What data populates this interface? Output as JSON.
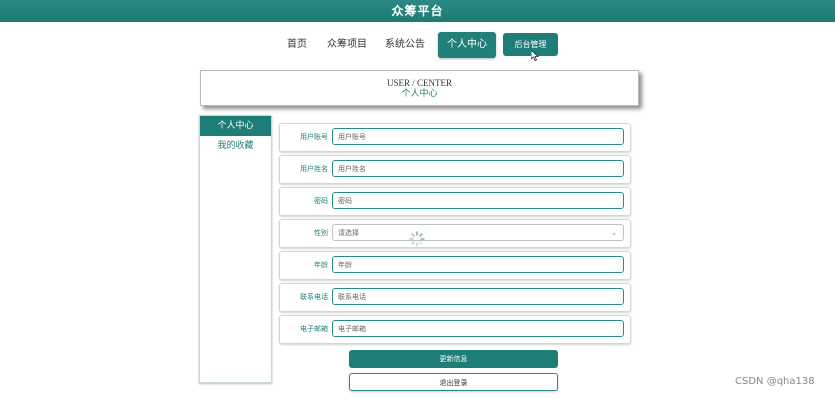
{
  "header": {
    "title": "众筹平台"
  },
  "nav": {
    "items": [
      "首页",
      "众筹项目",
      "系统公告",
      "个人中心"
    ],
    "admin_label": "后台管理"
  },
  "banner": {
    "en": "USER / CENTER",
    "cn": "个人中心"
  },
  "sidebar": {
    "items": [
      "个人中心",
      "我的收藏"
    ]
  },
  "form": {
    "fields": [
      {
        "label": "用户账号",
        "placeholder": "用户账号"
      },
      {
        "label": "用户姓名",
        "placeholder": "用户姓名"
      },
      {
        "label": "密码",
        "placeholder": "密码"
      },
      {
        "label": "性别",
        "placeholder": "请选择"
      },
      {
        "label": "年龄",
        "placeholder": "年龄"
      },
      {
        "label": "联系电话",
        "placeholder": "联系电话"
      },
      {
        "label": "电子邮箱",
        "placeholder": "电子邮箱"
      }
    ],
    "update_label": "更新信息",
    "logout_label": "退出登录"
  },
  "watermark": "CSDN @qha138",
  "colors": {
    "accent": "#1f7d77"
  }
}
